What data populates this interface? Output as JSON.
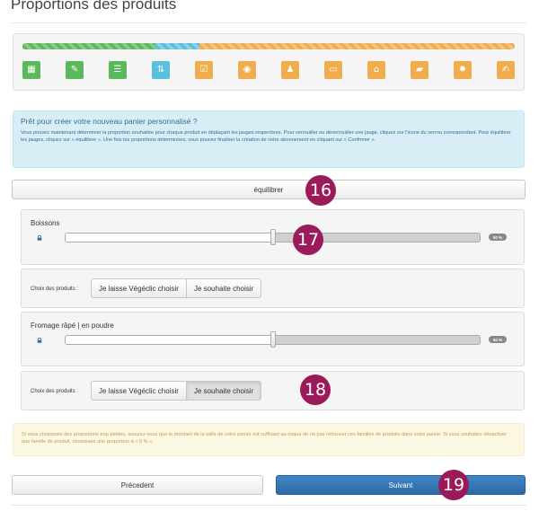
{
  "page": {
    "title": "Proportions des produits"
  },
  "progress": {
    "segments": [
      {
        "color": "#5cb85c",
        "fraction": 0.27
      },
      {
        "color": "#5bc0de",
        "fraction": 0.09
      },
      {
        "color": "#f0ad4e",
        "fraction": 0.64
      }
    ]
  },
  "steps": [
    {
      "icon": "grid-icon",
      "glyph": "▦",
      "color": "#5cb85c"
    },
    {
      "icon": "wrench-icon",
      "glyph": "✎",
      "color": "#5cb85c"
    },
    {
      "icon": "list-icon",
      "glyph": "☰",
      "color": "#5cb85c"
    },
    {
      "icon": "sort-icon",
      "glyph": "⇅",
      "color": "#5bc0de"
    },
    {
      "icon": "checklist-icon",
      "glyph": "☑",
      "color": "#f0ad4e"
    },
    {
      "icon": "eye-icon",
      "glyph": "◉",
      "color": "#f0ad4e"
    },
    {
      "icon": "user-icon",
      "glyph": "♟",
      "color": "#f0ad4e"
    },
    {
      "icon": "card-icon",
      "glyph": "▭",
      "color": "#f0ad4e"
    },
    {
      "icon": "home-icon",
      "glyph": "⌂",
      "color": "#f0ad4e"
    },
    {
      "icon": "comment-icon",
      "glyph": "▰",
      "color": "#f0ad4e"
    },
    {
      "icon": "certificate-icon",
      "glyph": "✹",
      "color": "#f0ad4e"
    },
    {
      "icon": "signature-icon",
      "glyph": "✍",
      "color": "#f0ad4e"
    }
  ],
  "info": {
    "heading": "Prêt pour créer votre nouveau panier personnalisé ?",
    "body": "Vous pouvez maintenant déterminer la proportion souhaitée pour chaque produit en déplaçant les jauges respectives. Pour verrouiller ou déverrouiller une jauge, cliquez sur l'icone du verrou correspondant. Pour équilibrer les jauges, cliquez sur « équilibrer ». Une fois les proportions déterminées, vous pouvez finaliser la création de votre abonnement en cliquant sur « Confirmer »."
  },
  "balance_label": "équilibrer",
  "sliders": [
    {
      "label": "Boissons",
      "value_percent": 50,
      "badge": "50 %"
    },
    {
      "label": "Fromage râpé | en poudre",
      "value_percent": 50,
      "badge": "50 %"
    }
  ],
  "choices": [
    {
      "label": "Choix des produits :",
      "option_auto": "Je laisse Végéclic choisir",
      "option_self": "Je souhaite choisir",
      "active": "none"
    },
    {
      "label": "Choix des produits :",
      "option_auto": "Je laisse Végéclic choisir",
      "option_self": "Je souhaite choisir",
      "active": "self"
    }
  ],
  "warning": "Si vous choisissez des proportions trop petites, assurez-vous que le montant de la taille de votre panier est suffisant au risque de ne pas retrouver ces familles de produits dans votre panier. Si vous souhaitez désactiver une famille de produit, choisissez une proportion à « 0 % ».",
  "nav": {
    "previous_label": "Précedent",
    "next_label": "Suivant"
  },
  "markers": [
    "16",
    "17",
    "18",
    "19"
  ],
  "colors": {
    "marker": "#9b1b5a",
    "primary": "#337ab7",
    "info_bg": "#d9edf7",
    "warning_bg": "#fcf8e3"
  }
}
